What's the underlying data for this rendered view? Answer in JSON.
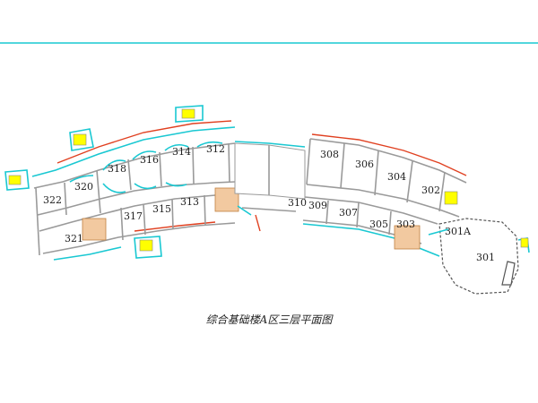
{
  "drawing": {
    "caption": "综合基础楼A区三层平面图",
    "rooms": [
      {
        "id": "r322",
        "label": "322"
      },
      {
        "id": "r320",
        "label": "320"
      },
      {
        "id": "r321",
        "label": "321"
      },
      {
        "id": "r318",
        "label": "318"
      },
      {
        "id": "r317",
        "label": "317"
      },
      {
        "id": "r316",
        "label": "316"
      },
      {
        "id": "r315",
        "label": "315"
      },
      {
        "id": "r314",
        "label": "314"
      },
      {
        "id": "r313",
        "label": "313"
      },
      {
        "id": "r312",
        "label": "312"
      },
      {
        "id": "r310",
        "label": "310"
      },
      {
        "id": "r309",
        "label": "309"
      },
      {
        "id": "r308",
        "label": "308"
      },
      {
        "id": "r307",
        "label": "307"
      },
      {
        "id": "r306",
        "label": "306"
      },
      {
        "id": "r305",
        "label": "305"
      },
      {
        "id": "r304",
        "label": "304"
      },
      {
        "id": "r303",
        "label": "303"
      },
      {
        "id": "r302",
        "label": "302"
      },
      {
        "id": "r301A",
        "label": "301A"
      },
      {
        "id": "r301",
        "label": "301"
      }
    ],
    "colors": {
      "border_line": "#19c8d2",
      "highlight_fill": "#ffff00",
      "stair_fill": "#f2c9a0",
      "exterior_accent": "#e04020"
    }
  }
}
